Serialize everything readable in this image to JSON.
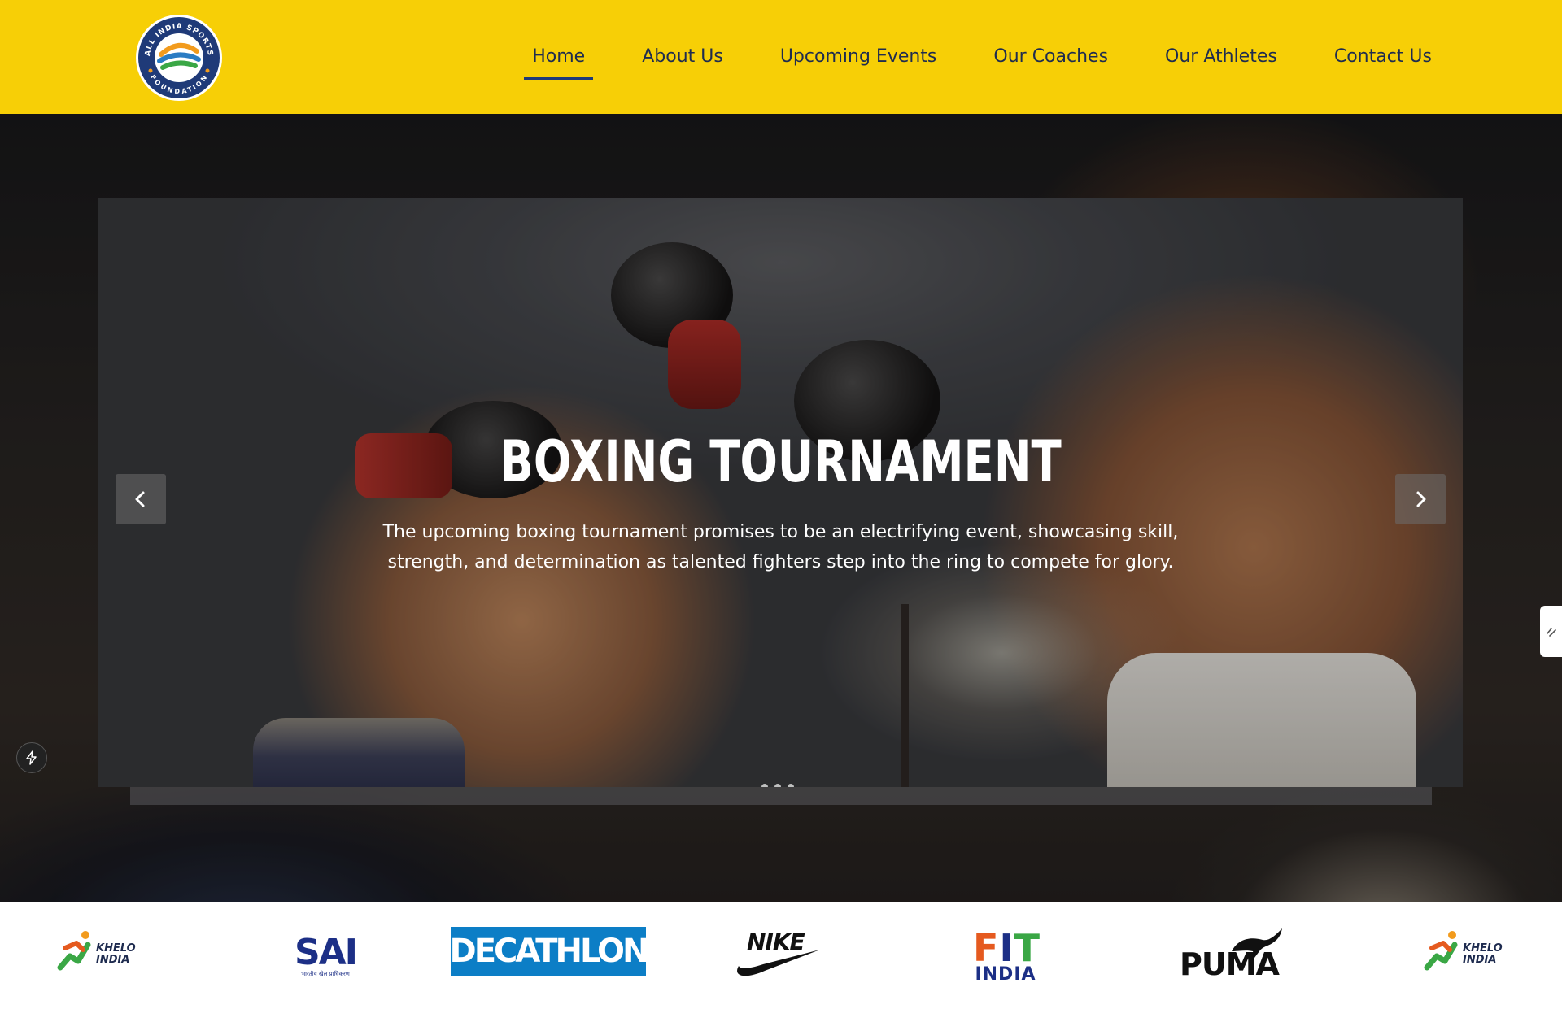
{
  "header": {
    "logo_text_top": "ALL INDIA SPORTS",
    "logo_text_bottom": "FOUNDATION",
    "nav": [
      {
        "label": "Home",
        "active": true
      },
      {
        "label": "About Us",
        "active": false
      },
      {
        "label": "Upcoming Events",
        "active": false
      },
      {
        "label": "Our Coaches",
        "active": false
      },
      {
        "label": "Our Athletes",
        "active": false
      },
      {
        "label": "Contact Us",
        "active": false
      }
    ]
  },
  "slider": {
    "title": "BOXING TOURNAMENT",
    "description": "The upcoming boxing tournament promises to be an electrifying event, showcasing skill, strength, and determination as talented fighters step into the ring to compete for glory.",
    "prev_icon": "chevron-left-icon",
    "next_icon": "chevron-right-icon",
    "slide_count": 3,
    "active_slide": 1
  },
  "partners": {
    "khelo": {
      "line1": "KHELO",
      "line2": "INDIA"
    },
    "sai": {
      "name": "SAI",
      "sub": "भारतीय खेल प्राधिकरण"
    },
    "decathlon": "DECATHLON",
    "nike": "NIKE",
    "fit": {
      "line1": "FIT",
      "line2": "INDIA"
    },
    "puma": "PUMA"
  },
  "colors": {
    "header_bg": "#f7cf06",
    "nav_text": "#1f2c4f",
    "decathlon_blue": "#0c7ec6",
    "sai_blue": "#1c2f86"
  }
}
